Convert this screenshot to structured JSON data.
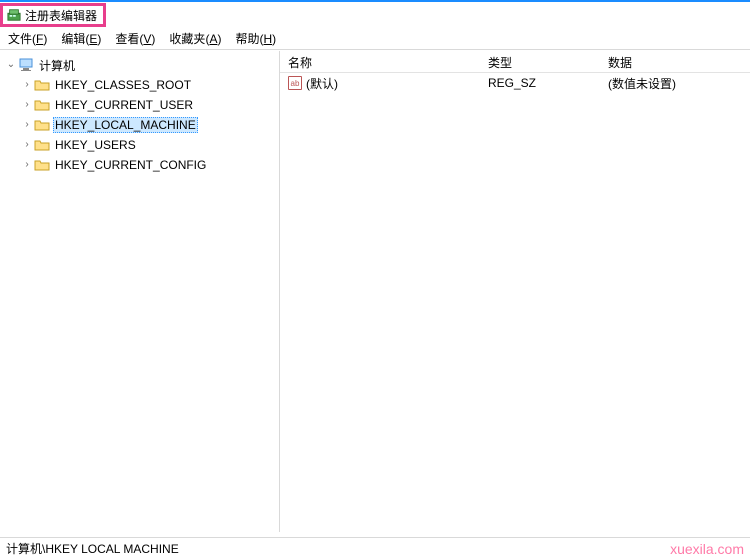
{
  "window": {
    "title": "注册表编辑器"
  },
  "menu": {
    "file": {
      "label": "文件",
      "hotkey": "F"
    },
    "edit": {
      "label": "编辑",
      "hotkey": "E"
    },
    "view": {
      "label": "查看",
      "hotkey": "V"
    },
    "fav": {
      "label": "收藏夹",
      "hotkey": "A"
    },
    "help": {
      "label": "帮助",
      "hotkey": "H"
    }
  },
  "tree": {
    "root": {
      "label": "计算机",
      "expanded": true
    },
    "items": [
      {
        "label": "HKEY_CLASSES_ROOT"
      },
      {
        "label": "HKEY_CURRENT_USER"
      },
      {
        "label": "HKEY_LOCAL_MACHINE"
      },
      {
        "label": "HKEY_USERS"
      },
      {
        "label": "HKEY_CURRENT_CONFIG"
      }
    ],
    "selected_index": 2
  },
  "columns": {
    "name": "名称",
    "type": "类型",
    "data": "数据"
  },
  "values": [
    {
      "name": "(默认)",
      "type": "REG_SZ",
      "data": "(数值未设置)"
    }
  ],
  "status": {
    "path": "计算机\\HKEY LOCAL MACHINE"
  },
  "watermark": "xuexila.com"
}
